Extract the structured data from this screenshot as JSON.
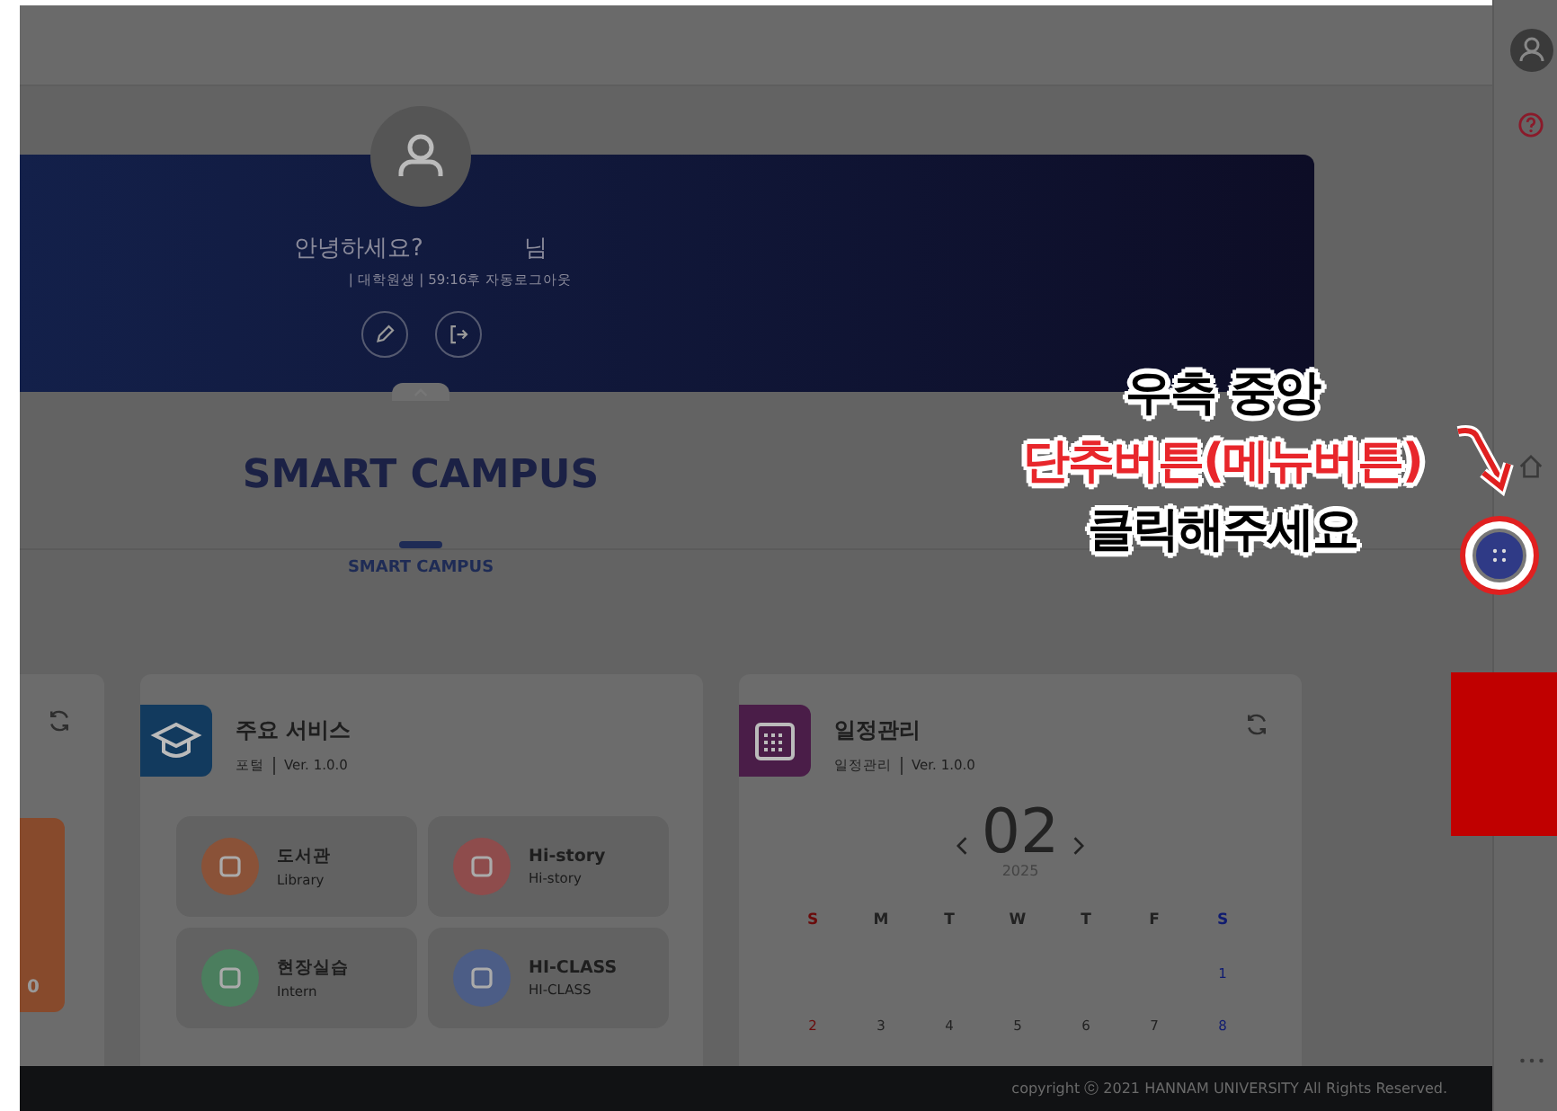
{
  "profile": {
    "greeting": "안녕하세요?",
    "honorific": "님",
    "info": "| 대학원생 | 59:16후 자동로그아웃"
  },
  "hero": {
    "title": "SMART CAMPUS"
  },
  "tabs": [
    {
      "label": "SMART CAMPUS",
      "selected": true
    }
  ],
  "cards": [
    {
      "kind": "partial",
      "value": "0"
    },
    {
      "kind": "services",
      "title": "주요 서비스",
      "source": "포털",
      "version": "Ver. 1.0.0",
      "services": [
        {
          "name": "도서관",
          "subtitle": "Library",
          "color": "#8a5238"
        },
        {
          "name": "Hi-story",
          "subtitle": "Hi-story",
          "color": "#8e4c4c"
        },
        {
          "name": "현장실습",
          "subtitle": "Intern",
          "color": "#4b7e5e"
        },
        {
          "name": "HI-CLASS",
          "subtitle": "HI-CLASS",
          "color": "#4c5d86"
        }
      ]
    },
    {
      "kind": "calendar",
      "title": "일정관리",
      "source": "일정관리",
      "version": "Ver. 1.0.0",
      "month": "02",
      "year": "2025",
      "weekdays": [
        {
          "label": "S",
          "kind": "sunday"
        },
        {
          "label": "M",
          "kind": "weekday"
        },
        {
          "label": "T",
          "kind": "weekday"
        },
        {
          "label": "W",
          "kind": "weekday"
        },
        {
          "label": "T",
          "kind": "weekday"
        },
        {
          "label": "F",
          "kind": "weekday"
        },
        {
          "label": "S",
          "kind": "saturday"
        }
      ],
      "weeks": [
        {
          "kind": "trailing",
          "days": [
            "1"
          ]
        },
        {
          "kind": "full",
          "days": [
            "2",
            "3",
            "4",
            "5",
            "6",
            "7",
            "8"
          ]
        }
      ]
    }
  ],
  "footer": {
    "copyright": "copyright ⓒ 2021 HANNAM UNIVERSITY All Rights Reserved."
  },
  "annotation": {
    "lines": [
      {
        "text": "우측 중앙",
        "kind": "normal"
      },
      {
        "text": "단추버튼(메뉴버튼)",
        "kind": "highlight"
      },
      {
        "text": "클릭해주세요",
        "kind": "normal"
      }
    ]
  }
}
